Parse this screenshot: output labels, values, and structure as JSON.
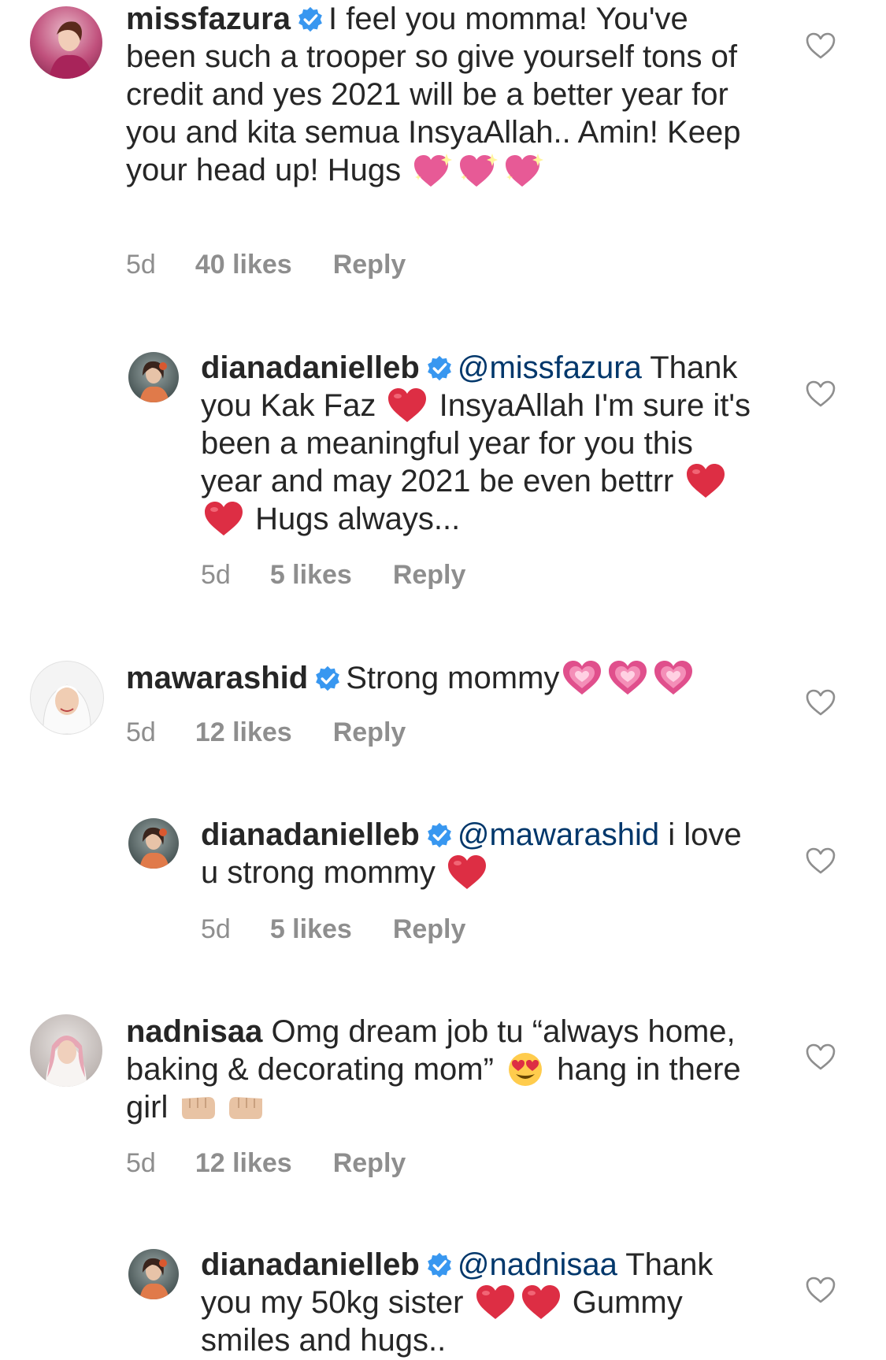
{
  "comments": [
    {
      "username": "missfazura",
      "text_1": "I feel you momma! You've been such a trooper so give yourself tons of credit and yes 2021 will be a better year for you and kita semua InsyaAllah.. Amin! Keep your head up! Hugs",
      "emojis": [
        "sparkling-heart-emoji",
        "sparkling-heart-emoji",
        "sparkling-heart-emoji"
      ],
      "time": "5d",
      "likes": "40 likes",
      "reply": "Reply"
    },
    {
      "username": "dianadanielleb",
      "mention": "@missfazura",
      "text_1": "Thank you Kak Faz",
      "text_2": "InsyaAllah I'm sure it's been a meaningful year for you this year and may 2021 be even bettrr",
      "text_3": "Hugs always...",
      "time": "5d",
      "likes": "5 likes",
      "reply": "Reply"
    },
    {
      "username": "mawarashid",
      "text_1": "Strong mommy",
      "time": "5d",
      "likes": "12 likes",
      "reply": "Reply"
    },
    {
      "username": "dianadanielleb",
      "mention": "@mawarashid",
      "text_1": "i love u strong mommy",
      "time": "5d",
      "likes": "5 likes",
      "reply": "Reply"
    },
    {
      "username": "nadnisaa",
      "text_1": "Omg dream job tu “always home, baking & decorating mom”",
      "text_2": "hang in there girl",
      "time": "5d",
      "likes": "12 likes",
      "reply": "Reply"
    },
    {
      "username": "dianadanielleb",
      "mention": "@nadnisaa",
      "text_1": "Thank you my 50kg sister",
      "text_2": "Gummy smiles and hugs..",
      "time": "",
      "likes": "",
      "reply": ""
    }
  ],
  "colors": {
    "verified": "#3897f0",
    "mention": "#00376b",
    "meta": "#8e8e8e",
    "text": "#262626"
  }
}
